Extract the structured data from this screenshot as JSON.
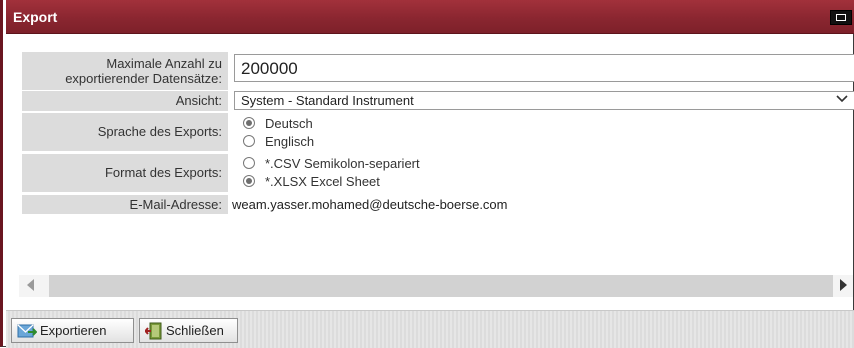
{
  "window": {
    "title": "Export"
  },
  "form": {
    "max_records_label": "Maximale Anzahl zu exportierender Datensätze:",
    "max_records_value": "200000",
    "view_label": "Ansicht:",
    "view_value": "System - Standard Instrument",
    "language_label": "Sprache des Exports:",
    "language_options": [
      {
        "label": "Deutsch",
        "selected": true
      },
      {
        "label": "Englisch",
        "selected": false
      }
    ],
    "format_label": "Format des Exports:",
    "format_options": [
      {
        "label": "*.CSV Semikolon-separiert",
        "selected": false
      },
      {
        "label": "*.XLSX Excel Sheet",
        "selected": true
      }
    ],
    "email_label": "E-Mail-Adresse:",
    "email_value": "weam.yasser.mohamed@deutsche-boerse.com"
  },
  "footer": {
    "export_label": "Exportieren",
    "close_label": "Schließen"
  },
  "colors": {
    "titlebar": "#8a2630",
    "label_bg": "#dcdcdc"
  }
}
